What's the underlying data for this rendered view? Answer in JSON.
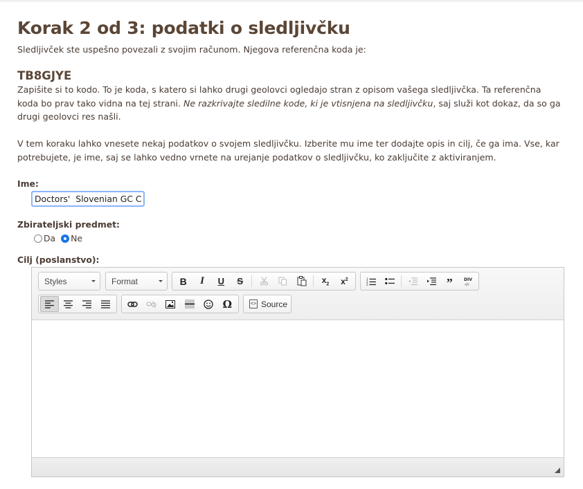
{
  "page": {
    "title": "Korak 2 od 3: podatki o sledljivčku",
    "intro": "Sledljivček ste uspešno povezali z svojim računom. Njegova referenčna koda je:",
    "code": "TB8GJYE",
    "para1_a": "Zapišite si to kodo. To je koda, s katero si lahko drugi geolovci ogledajo stran z opisom vašega sledljivčka. Ta referenčna koda bo prav tako vidna na tej strani. ",
    "para1_em": "Ne razkrivajte sledilne kode, ki je vtisnjena na sledljivčku",
    "para1_b": ", saj služi kot dokaz, da so ga drugi geolovci res našli.",
    "para2": "V tem koraku lahko vnesete nekaj podatkov o svojem sledljivčku. Izberite mu ime ter dodajte opis in cilj, če ga ima. Vse, kar potrebujete, je ime, saj se lahko vedno vrnete na urejanje podatkov o sledljivčku, ko zaključite z aktiviranjem."
  },
  "form": {
    "name_label": "Ime:",
    "name_value": "Doctors'  Slovenian GC Clu",
    "collectible_label": "Zbirateljski predmet:",
    "radio_yes": "Da",
    "radio_no": "Ne",
    "radio_selected": "Ne",
    "goal_label": "Cilj (poslanstvo):"
  },
  "editor": {
    "styles_label": "Styles",
    "format_label": "Format",
    "source_label": "Source",
    "buttons_row1": [
      "bold-icon",
      "italic-icon",
      "underline-icon",
      "strikethrough-icon",
      "cut-icon",
      "copy-icon",
      "paste-icon",
      "subscript-icon",
      "superscript-icon",
      "numbered-list-icon",
      "bulleted-list-icon",
      "outdent-icon",
      "indent-icon",
      "blockquote-icon",
      "div-container-icon"
    ],
    "buttons_row2": [
      "align-left-icon",
      "align-center-icon",
      "align-right-icon",
      "justify-icon",
      "link-icon",
      "unlink-icon",
      "image-icon",
      "horizontal-line-icon",
      "smiley-icon",
      "special-char-icon",
      "source-icon"
    ],
    "colors": {
      "accent": "#1a73e8",
      "input_focus": "#8ab4f8",
      "heading": "#5b4636"
    }
  }
}
